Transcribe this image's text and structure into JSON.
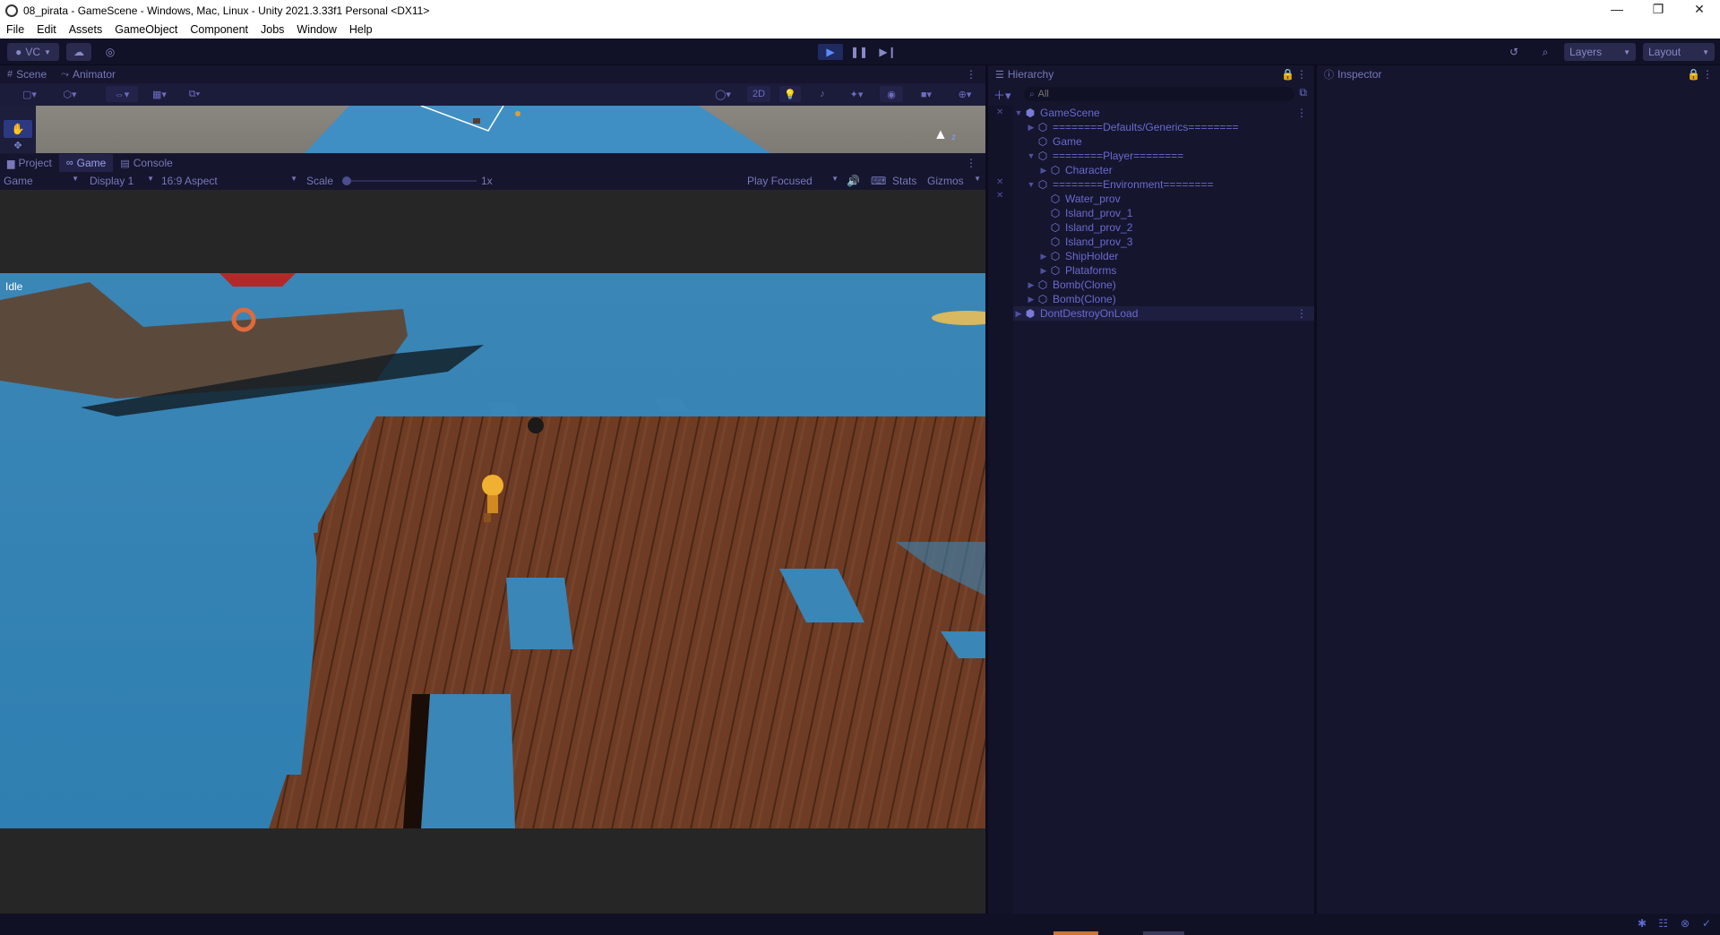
{
  "window": {
    "title": "08_pirata - GameScene - Windows, Mac, Linux - Unity 2021.3.33f1 Personal <DX11>",
    "controls": [
      "—",
      "❐",
      "✕"
    ]
  },
  "menu": [
    "File",
    "Edit",
    "Assets",
    "GameObject",
    "Component",
    "Jobs",
    "Window",
    "Help"
  ],
  "toolbar": {
    "vc_label": "VC",
    "layers_label": "Layers",
    "layout_label": "Layout"
  },
  "scene_tabs": [
    {
      "label": "Scene",
      "icon": "#"
    },
    {
      "label": "Animator",
      "icon": "⤳"
    }
  ],
  "scene_toolbar": {
    "mode_2d": "2D"
  },
  "game_tabs": [
    {
      "label": "Project",
      "icon": "▆"
    },
    {
      "label": "Game",
      "icon": "∞"
    },
    {
      "label": "Console",
      "icon": "▤"
    }
  ],
  "game_toolbar": {
    "display_type": "Game",
    "display": "Display 1",
    "aspect": "16:9 Aspect",
    "scale_label": "Scale",
    "scale_value": "1x",
    "play_mode": "Play Focused",
    "stats": "Stats",
    "gizmos": "Gizmos"
  },
  "game_overlay": {
    "state_text": "Idle"
  },
  "hierarchy": {
    "title": "Hierarchy",
    "search_placeholder": "All",
    "items": [
      {
        "label": "GameScene",
        "depth": 0,
        "arrow": "▼",
        "scene": true
      },
      {
        "label": "========Defaults/Generics========",
        "depth": 1,
        "arrow": "▶"
      },
      {
        "label": "Game",
        "depth": 1,
        "arrow": ""
      },
      {
        "label": "========Player========",
        "depth": 1,
        "arrow": "▼"
      },
      {
        "label": "Character",
        "depth": 2,
        "arrow": "▶"
      },
      {
        "label": "========Environment========",
        "depth": 1,
        "arrow": "▼"
      },
      {
        "label": "Water_prov",
        "depth": 2,
        "arrow": ""
      },
      {
        "label": "Island_prov_1",
        "depth": 2,
        "arrow": ""
      },
      {
        "label": "Island_prov_2",
        "depth": 2,
        "arrow": ""
      },
      {
        "label": "Island_prov_3",
        "depth": 2,
        "arrow": ""
      },
      {
        "label": "ShipHolder",
        "depth": 2,
        "arrow": "▶"
      },
      {
        "label": "Plataforms",
        "depth": 2,
        "arrow": "▶"
      },
      {
        "label": "Bomb(Clone)",
        "depth": 1,
        "arrow": "▶"
      },
      {
        "label": "Bomb(Clone)",
        "depth": 1,
        "arrow": "▶"
      },
      {
        "label": "DontDestroyOnLoad",
        "depth": 0,
        "arrow": "▶",
        "scene": true
      }
    ]
  },
  "inspector": {
    "title": "Inspector"
  },
  "colors": {
    "accent": "#5a8cff",
    "panel": "#15152e",
    "text": "#6a6ad0",
    "water": "#2f86b8",
    "wood": "#6b3a22"
  }
}
